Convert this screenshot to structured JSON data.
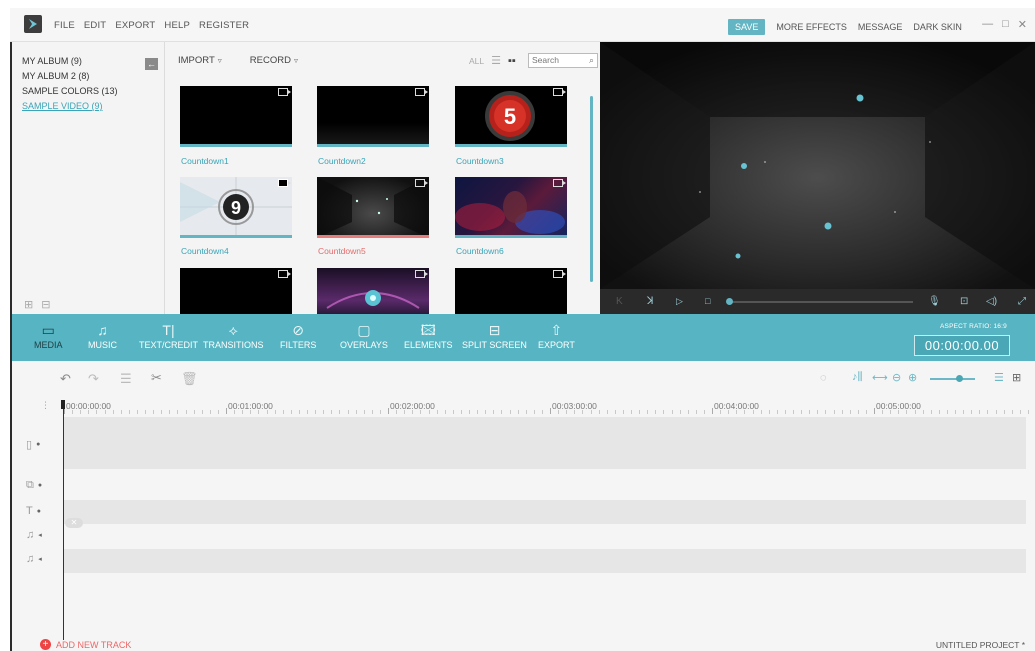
{
  "menu": [
    "FILE",
    "EDIT",
    "EXPORT",
    "HELP",
    "REGISTER"
  ],
  "topbar": {
    "save": "SAVE",
    "more_effects": "MORE EFFECTS",
    "message": "MESSAGE",
    "dark_skin": "DARK SKIN",
    "minimize": "—",
    "maximize": "□",
    "close": "✕"
  },
  "library": {
    "albums": [
      "MY ALBUM (9)",
      "MY ALBUM 2 (8)",
      "SAMPLE COLORS (13)",
      "SAMPLE VIDEO (9)"
    ],
    "active_album": "SAMPLE VIDEO (9)",
    "import": "IMPORT",
    "record": "RECORD",
    "all": "ALL",
    "search_placeholder": "Search",
    "thumbnails": [
      {
        "label": "Countdown1"
      },
      {
        "label": "Countdown2"
      },
      {
        "label": "Countdown3",
        "digit": "5"
      },
      {
        "label": "Countdown4",
        "digit": "9"
      },
      {
        "label": "Countdown5",
        "selected": true
      },
      {
        "label": "Countdown6"
      },
      {
        "label": ""
      },
      {
        "label": ""
      },
      {
        "label": ""
      }
    ]
  },
  "toolbar": {
    "tools": [
      "MEDIA",
      "MUSIC",
      "TEXT/CREDIT",
      "TRANSITIONS",
      "FILTERS",
      "OVERLAYS",
      "ELEMENTS",
      "SPLIT SCREEN",
      "EXPORT"
    ],
    "active": "MEDIA",
    "aspect_ratio": "ASPECT RATIO: 16:9",
    "timecode": "00:00:00.00"
  },
  "timeline": {
    "ruler": [
      "00:00:00:00",
      "00:01:00:00",
      "00:02:00:00",
      "00:03:00:00",
      "00:04:00:00",
      "00:05:00:00"
    ],
    "add_new_track": "ADD NEW TRACK",
    "project_name": "UNTITLED PROJECT *"
  },
  "colors": {
    "accent": "#57b4c2",
    "preview_bg": "#1b1b1b",
    "add_track": "#e44444"
  }
}
